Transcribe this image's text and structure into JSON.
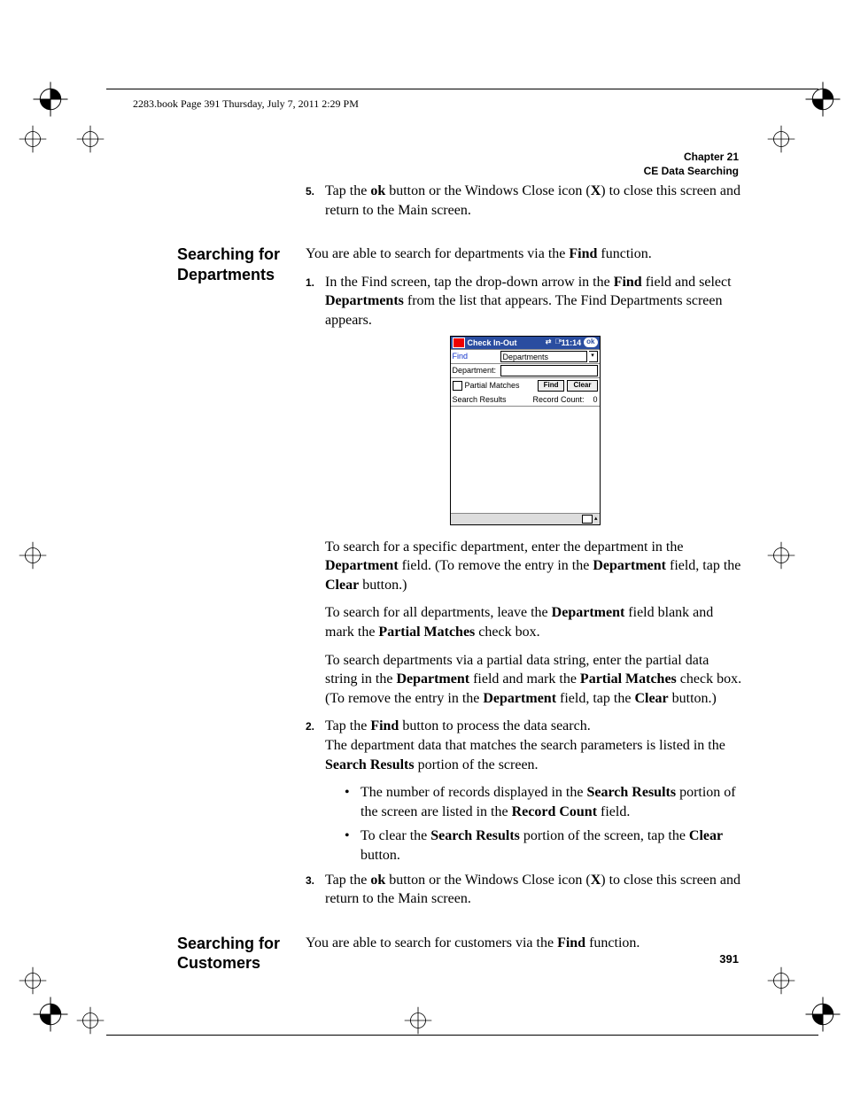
{
  "header_ref": "2283.book  Page 391  Thursday, July 7, 2011  2:29 PM",
  "chapter": {
    "line1": "Chapter 21",
    "line2": "CE Data Searching"
  },
  "page_number": "391",
  "section_dept": {
    "heading": "Searching for Departments",
    "intro_pre": "You are able to search for departments via the ",
    "intro_bold": "Find",
    "intro_post": " function.",
    "prev_step_num": "5.",
    "prev_step": "Tap the <b>ok</b> button or the Windows Close icon (<b>X</b>) to close this screen and return to the Main screen.",
    "step1_num": "1.",
    "step1": "In the Find screen, tap the drop-down arrow in the <b>Find</b> field and select <b>Departments</b> from the list that appears. The Find Departments screen appears.",
    "after1a": "To search for a specific department, enter the department in the <b>Department</b> field. (To remove the entry in the <b>Department</b> field, tap the <b>Clear</b> button.)",
    "after1b": "To search for all departments, leave the <b>Department</b> field blank and mark the <b>Partial Matches</b> check box.",
    "after1c": "To search departments via a partial data string, enter the partial data string in the <b>Department</b> field and mark the <b>Partial Matches</b> check box. (To remove the entry in the <b>Department</b> field, tap the <b>Clear</b> button.)",
    "step2_num": "2.",
    "step2": "Tap the <b>Find</b> button to process the data search.",
    "after2a": "The department data that matches the search parameters is listed in the <b>Search Results</b> portion of the screen.",
    "bullet_a": "The number of records displayed in the <b>Search Results</b> portion of the screen are listed in the <b>Record Count</b> field.",
    "bullet_b": "To clear the <b>Search Results</b> portion of the screen, tap the <b>Clear</b> button.",
    "step3_num": "3.",
    "step3": "Tap the <b>ok</b> button or the Windows Close icon (<b>X</b>) to close this screen and return to the Main screen."
  },
  "section_cust": {
    "heading": "Searching for Customers",
    "intro_pre": "You are able to search for customers via the ",
    "intro_bold": "Find",
    "intro_post": " function."
  },
  "device": {
    "title": "Check In-Out",
    "time": "11:14",
    "ok": "ok",
    "find_lbl": "Find",
    "find_val": "Departments",
    "dept_lbl": "Department:",
    "partial": "Partial Matches",
    "btn_find": "Find",
    "btn_clear": "Clear",
    "results": "Search Results",
    "count_lbl": "Record Count:",
    "count_val": "0"
  }
}
